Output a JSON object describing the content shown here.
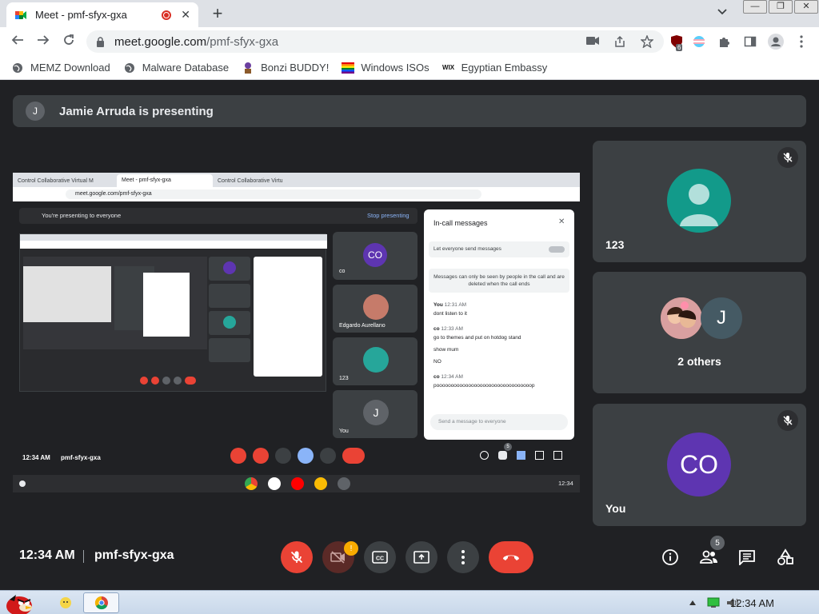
{
  "browser": {
    "tab_title": "Meet - pmf-sfyx-gxa",
    "url_host": "meet.google.com",
    "url_path": "/pmf-sfyx-gxa",
    "ext_badge": "6",
    "window_controls": [
      "—",
      "❐",
      "✕"
    ]
  },
  "bookmarks": [
    {
      "label": "MEMZ Download",
      "icon": "globe-icon"
    },
    {
      "label": "Malware Database",
      "icon": "globe-icon"
    },
    {
      "label": "Bonzi BUDDY!",
      "icon": "bonzi-icon"
    },
    {
      "label": "Windows ISOs",
      "icon": "rainbow-flag-icon"
    },
    {
      "label": "Egyptian Embassy",
      "icon": "wix-icon"
    }
  ],
  "presenting": {
    "avatar_letter": "J",
    "text": "Jamie Arruda is presenting"
  },
  "tiles": [
    {
      "name": "123",
      "muted": true
    },
    {
      "name": "2 others",
      "letter": "J"
    },
    {
      "name": "You",
      "initials": "CO",
      "muted": true
    }
  ],
  "controls": {
    "time": "12:34 AM",
    "meeting_code": "pmf-sfyx-gxa",
    "camera_alert": "!",
    "participants_count": "5"
  },
  "shared_screen": {
    "tabs": [
      "Control Collaborative Virtual M",
      "Meet - pmf-sfyx-gxa",
      "Control Collaborative Virtu"
    ],
    "url": "meet.google.com/pmf-sfyx-gxa",
    "presenting_notice": "You're presenting to everyone",
    "stop_label": "Stop presenting",
    "tiles": [
      {
        "initials": "CO",
        "name": "co"
      },
      {
        "name": "Edgardo Aurellano"
      },
      {
        "name": "123"
      },
      {
        "letter": "J",
        "name": "You"
      }
    ],
    "chat": {
      "title": "In-call messages",
      "toggle_label": "Let everyone send messages",
      "notice": "Messages can only be seen by people in the call and are deleted when the call ends",
      "messages": [
        {
          "sender": "You",
          "time": "12:31 AM",
          "lines": [
            "dont listen to it"
          ]
        },
        {
          "sender": "co",
          "time": "12:33 AM",
          "lines": [
            "go to themes and put on hotdog stand",
            "show mum",
            "NO"
          ]
        },
        {
          "sender": "co",
          "time": "12:34 AM",
          "lines": [
            "pooooooooooooooooooooooooooooooooop"
          ]
        }
      ],
      "input_placeholder": "Send a message to everyone"
    },
    "time": "12:34 AM",
    "code": "pmf-sfyx-gxa",
    "people_badge": "5",
    "shelf_time": "12:34"
  },
  "taskbar": {
    "time": "12:34 AM"
  }
}
